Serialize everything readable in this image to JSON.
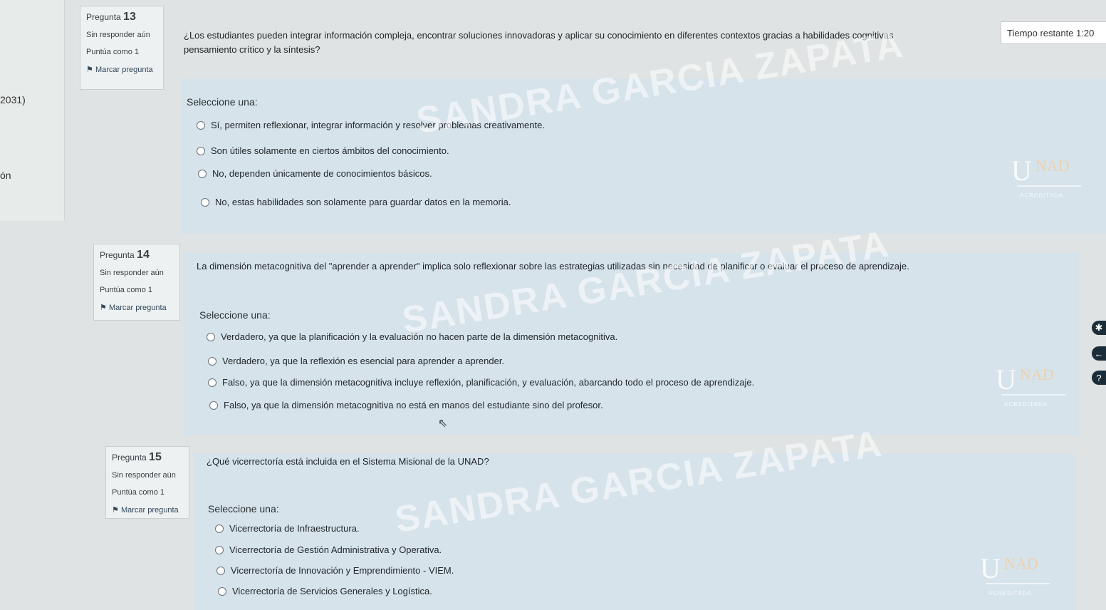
{
  "timer": {
    "label": "Tiempo restante 1:20"
  },
  "left_fragments": {
    "code": "2031)",
    "word": "ón"
  },
  "questions": [
    {
      "label": "Pregunta",
      "number": "13",
      "status": "Sin responder aún",
      "score": "Puntúa como 1",
      "flag": "Marcar pregunta",
      "text_line1": "¿Los estudiantes pueden integrar información compleja, encontrar soluciones innovadoras y aplicar su conocimiento en diferentes contextos gracias a habilidades cognitivas",
      "text_line2": "pensamiento crítico y la síntesis?",
      "select": "Seleccione una:",
      "options": [
        "Sí, permiten reflexionar, integrar información y resolver problemas creativamente.",
        "Son útiles solamente en ciertos ámbitos del conocimiento.",
        "No, dependen únicamente de conocimientos básicos.",
        "No, estas habilidades son solamente para guardar datos en la memoria."
      ]
    },
    {
      "label": "Pregunta",
      "number": "14",
      "status": "Sin responder aún",
      "score": "Puntúa como 1",
      "flag": "Marcar pregunta",
      "text_line1": "La dimensión metacognitiva del \"aprender a aprender\" implica solo reflexionar sobre las estrategias utilizadas sin necesidad de planificar o evaluar el proceso de aprendizaje.",
      "select": "Seleccione una:",
      "options": [
        "Verdadero, ya que la planificación y la evaluación no hacen parte de la dimensión metacognitiva.",
        "Verdadero, ya que la reflexión es esencial para aprender a aprender.",
        "Falso, ya que la dimensión metacognitiva incluye reflexión, planificación, y evaluación, abarcando todo el proceso de aprendizaje.",
        "Falso, ya que la dimensión metacognitiva no está en manos del estudiante sino del profesor."
      ]
    },
    {
      "label": "Pregunta",
      "number": "15",
      "status": "Sin responder aún",
      "score": "Puntúa como 1",
      "flag": "Marcar pregunta",
      "text_line1": "¿Qué vicerrectoría está incluida en el Sistema Misional de la UNAD?",
      "select": "Seleccione una:",
      "options": [
        "Vicerrectoría de Infraestructura.",
        "Vicerrectoría de Gestión Administrativa y Operativa.",
        "Vicerrectoría de Innovación y Emprendimiento - VIEM.",
        "Vicerrectoría de Servicios Generales y Logística."
      ]
    }
  ],
  "watermark": "SANDRA GARCIA ZAPATA",
  "logo": {
    "letters": "UNAD",
    "u": "U",
    "rest": "NAD",
    "accreditation": "ACREDITADA"
  },
  "icons": {
    "flag": "flag-icon",
    "radio": "radio-icon",
    "cursor": "pointer-cursor-icon"
  }
}
